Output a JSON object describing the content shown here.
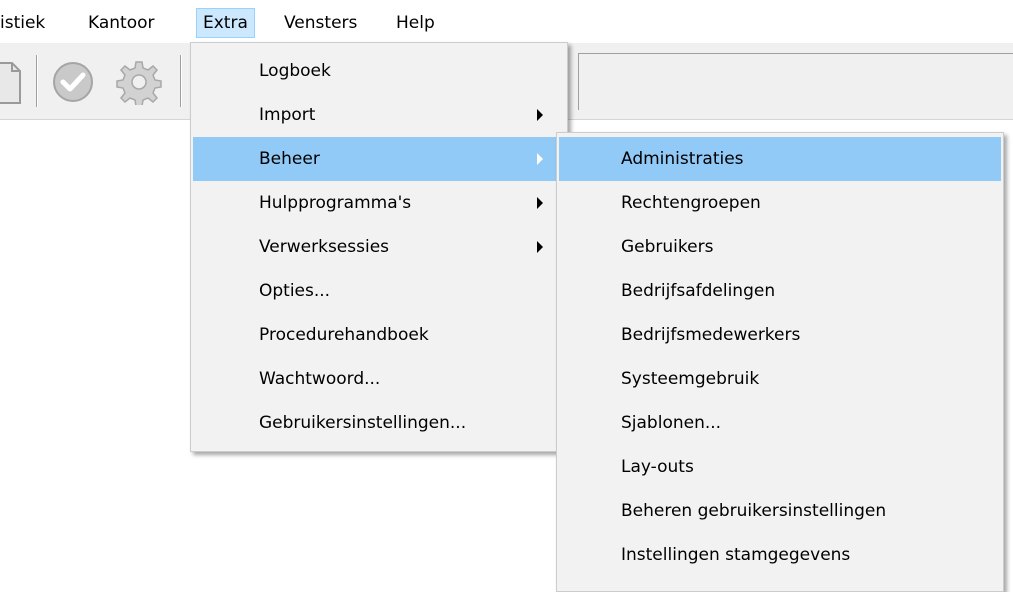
{
  "menubar": {
    "items": [
      {
        "label": "istiek"
      },
      {
        "label": "Kantoor"
      },
      {
        "label": "Extra"
      },
      {
        "label": "Vensters"
      },
      {
        "label": "Help"
      }
    ]
  },
  "toolbar": {
    "icons": [
      "document-icon",
      "check-circle-icon",
      "gear-icon"
    ]
  },
  "extra_menu": {
    "items": [
      {
        "label": "Logboek",
        "submenu": false
      },
      {
        "label": "Import",
        "submenu": true
      },
      {
        "label": "Beheer",
        "submenu": true,
        "highlighted": true
      },
      {
        "label": "Hulpprogramma's",
        "submenu": true
      },
      {
        "label": "Verwerksessies",
        "submenu": true
      },
      {
        "label": "Opties...",
        "submenu": false
      },
      {
        "label": "Procedurehandboek",
        "submenu": false
      },
      {
        "label": "Wachtwoord...",
        "submenu": false
      },
      {
        "label": "Gebruikersinstellingen...",
        "submenu": false
      }
    ]
  },
  "beheer_submenu": {
    "items": [
      {
        "label": "Administraties",
        "highlighted": true
      },
      {
        "label": "Rechtengroepen"
      },
      {
        "label": "Gebruikers"
      },
      {
        "label": "Bedrijfsafdelingen"
      },
      {
        "label": "Bedrijfsmedewerkers"
      },
      {
        "label": "Systeemgebruik"
      },
      {
        "label": "Sjablonen..."
      },
      {
        "label": "Lay-outs"
      },
      {
        "label": "Beheren gebruikersinstellingen"
      },
      {
        "label": "Instellingen stamgegevens"
      }
    ]
  },
  "colors": {
    "highlight": "#91c9f7",
    "menubar_active": "#cce8ff",
    "menu_bg": "#f2f2f2"
  }
}
